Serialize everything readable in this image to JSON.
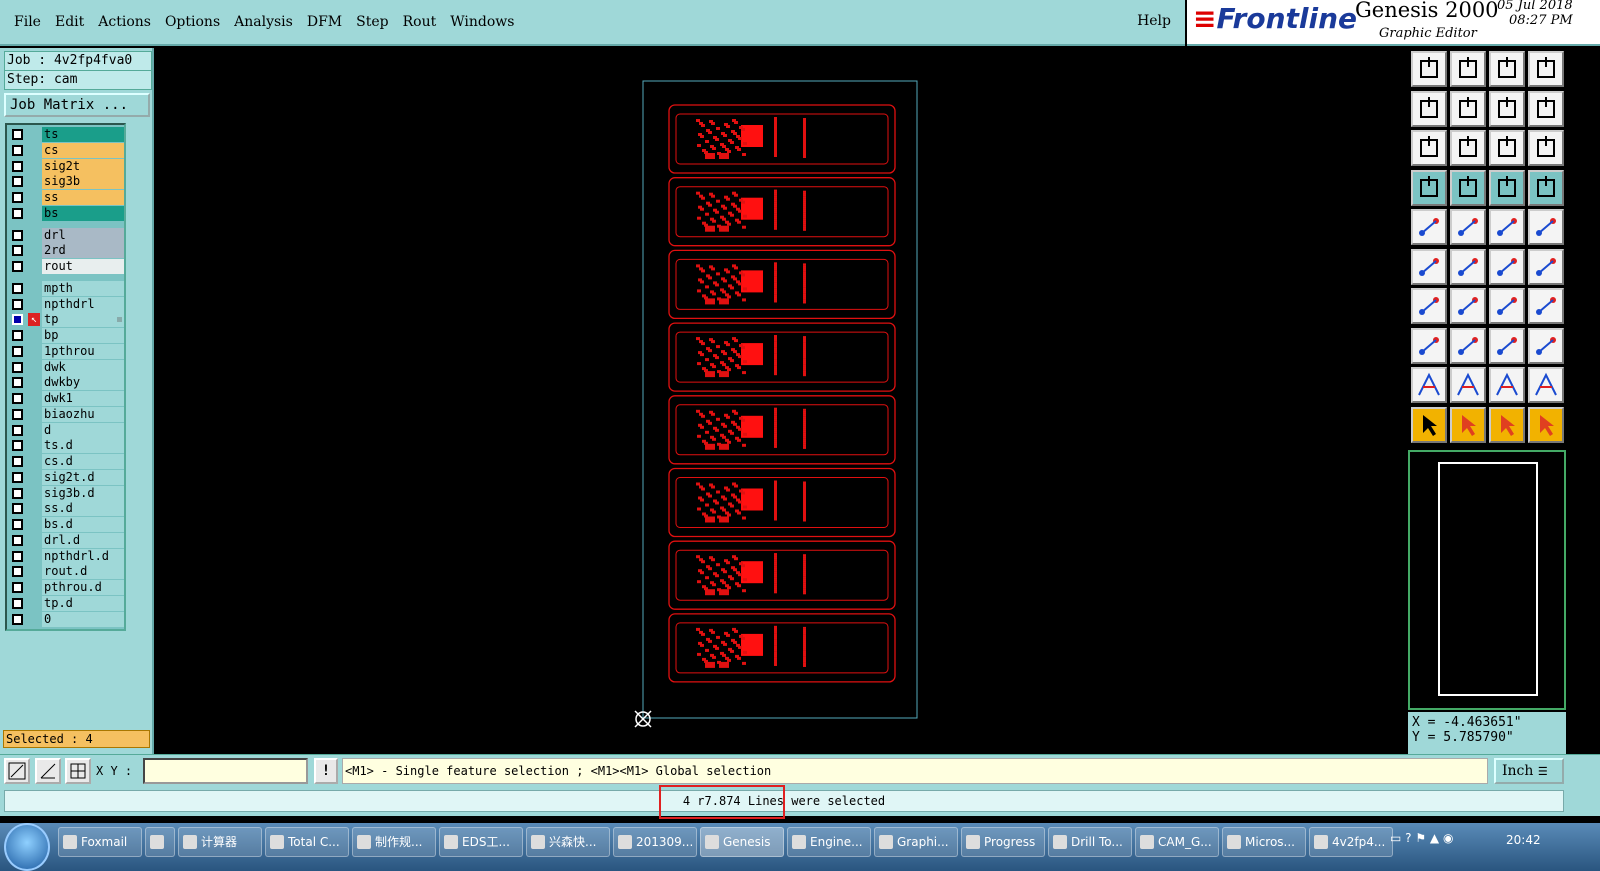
{
  "menu": [
    "File",
    "Edit",
    "Actions",
    "Options",
    "Analysis",
    "DFM",
    "Step",
    "Rout",
    "Windows"
  ],
  "help_label": "Help",
  "brand": {
    "logo": "Frontline",
    "product": "Genesis 2000",
    "subtitle": "Graphic Editor",
    "date": "05 Jul 2018",
    "time": "08:27 PM"
  },
  "job": {
    "job": "Job : 4v2fp4fva0",
    "step": "Step: cam",
    "matrix_button": "Job Matrix ..."
  },
  "layers": [
    {
      "name": "ts",
      "color": "#1a9e8a"
    },
    {
      "name": "cs",
      "color": "#f5c060"
    },
    {
      "name": "sig2t",
      "color": "#f5c060"
    },
    {
      "name": "sig3b",
      "color": "#f5c060"
    },
    {
      "name": "ss",
      "color": "#f5c060"
    },
    {
      "name": "bs",
      "color": "#1a9e8a"
    },
    {
      "name": "drl",
      "color": "#a9b9c6"
    },
    {
      "name": "2rd",
      "color": "#a9b9c6"
    },
    {
      "name": "rout",
      "color": "#e8eeee"
    },
    {
      "name": "mpth",
      "color": "#9fd8d8"
    },
    {
      "name": "npthdrl",
      "color": "#9fd8d8"
    },
    {
      "name": "tp",
      "color": "#9fd8d8",
      "affected": true
    },
    {
      "name": "bp",
      "color": "#9fd8d8"
    },
    {
      "name": "1pthrou",
      "color": "#9fd8d8"
    },
    {
      "name": "dwk",
      "color": "#9fd8d8"
    },
    {
      "name": "dwkby",
      "color": "#9fd8d8"
    },
    {
      "name": "dwk1",
      "color": "#9fd8d8"
    },
    {
      "name": "biaozhu",
      "color": "#9fd8d8"
    },
    {
      "name": "d",
      "color": "#9fd8d8"
    },
    {
      "name": "ts.d",
      "color": "#9fd8d8"
    },
    {
      "name": "cs.d",
      "color": "#9fd8d8"
    },
    {
      "name": "sig2t.d",
      "color": "#9fd8d8"
    },
    {
      "name": "sig3b.d",
      "color": "#9fd8d8"
    },
    {
      "name": "ss.d",
      "color": "#9fd8d8"
    },
    {
      "name": "bs.d",
      "color": "#9fd8d8"
    },
    {
      "name": "drl.d",
      "color": "#9fd8d8"
    },
    {
      "name": "npthdrl.d",
      "color": "#9fd8d8"
    },
    {
      "name": "rout.d",
      "color": "#9fd8d8"
    },
    {
      "name": "pthrou.d",
      "color": "#9fd8d8"
    },
    {
      "name": "tp.d",
      "color": "#9fd8d8"
    },
    {
      "name": "0",
      "color": "#9fd8d8"
    }
  ],
  "selected_count": "Selected : 4",
  "coords": {
    "x": "X = -4.463651\"",
    "y": "Y = 5.785790\""
  },
  "xy_label": "X Y :",
  "xy_value": "",
  "hint": "<M1> - Single feature selection ; <M1><M1> Global selection",
  "unit": "Inch",
  "status": "4 r7.874 Lines were selected",
  "taskbar": [
    {
      "label": "Foxmail"
    },
    {
      "label": ""
    },
    {
      "label": "计算器"
    },
    {
      "label": "Total C..."
    },
    {
      "label": "制作规..."
    },
    {
      "label": "EDS工..."
    },
    {
      "label": "兴森快..."
    },
    {
      "label": "201309..."
    },
    {
      "label": "Genesis",
      "active": true
    },
    {
      "label": "Engine..."
    },
    {
      "label": "Graphi..."
    },
    {
      "label": "Progress"
    },
    {
      "label": "Drill To..."
    },
    {
      "label": "CAM_G..."
    },
    {
      "label": "Micros..."
    },
    {
      "label": "4v2fp4..."
    }
  ],
  "clock": "20:42",
  "icons": [
    "start-orb-icon",
    "save-icon",
    "crosshair-icon",
    "arrow-pointer-icon"
  ]
}
